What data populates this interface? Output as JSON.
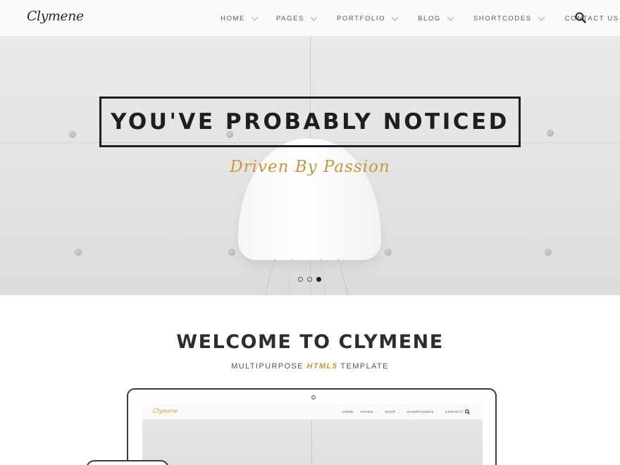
{
  "brand": {
    "logo": "Clymene",
    "accent_color": "#c9953a"
  },
  "nav": {
    "items": [
      {
        "label": "HOME",
        "has_dropdown": true
      },
      {
        "label": "PAGES",
        "has_dropdown": true
      },
      {
        "label": "PORTFOLIO",
        "has_dropdown": true
      },
      {
        "label": "BLOG",
        "has_dropdown": true
      },
      {
        "label": "SHORTCODES",
        "has_dropdown": true
      },
      {
        "label": "CONTACT US",
        "has_dropdown": false
      }
    ],
    "search_icon": "search-icon"
  },
  "hero": {
    "title": "YOU'VE PROBABLY NOTICED",
    "subtitle": "Driven By Passion",
    "slides_count": 3,
    "active_slide": 3
  },
  "welcome": {
    "title": "WELCOME TO CLYMENE",
    "subtitle_before": "MULTIPURPOSE ",
    "subtitle_accent": "HTML5",
    "subtitle_after": " TEMPLATE"
  },
  "mockup": {
    "logo": "Clymene",
    "menu": [
      "HOME",
      "PAGES",
      "SHOP",
      "SHORTCODES",
      "CONTACT"
    ]
  }
}
